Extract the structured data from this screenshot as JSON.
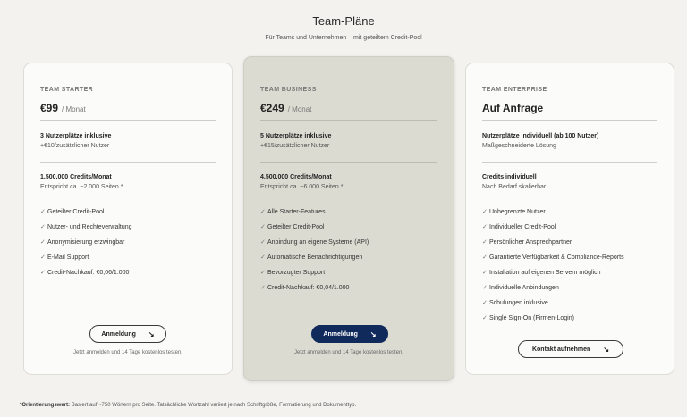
{
  "header": {
    "title": "Team-Pläne",
    "subtitle": "Für Teams und Unternehmen – mit geteiltem Credit-Pool"
  },
  "plans": [
    {
      "name": "TEAM STARTER",
      "price": "€99",
      "period": "/ Monat",
      "seats_title": "3 Nutzerplätze inklusive",
      "seats_sub": "+€10/zusätzlicher Nutzer",
      "credits_title": "1.500.000 Credits/Monat",
      "credits_sub": "Entspricht ca. ~2.000 Seiten *",
      "features": [
        "Geteilter Credit-Pool",
        "Nutzer- und Rechteverwaltung",
        "Anonymisierung erzwingbar",
        "E-Mail Support",
        "Credit-Nachkauf: €0,06/1.000"
      ],
      "button": "Anmeldung",
      "note": "Jetzt anmelden und 14 Tage kostenlos testen."
    },
    {
      "name": "TEAM BUSINESS",
      "price": "€249",
      "period": "/ Monat",
      "seats_title": "5 Nutzerplätze inklusive",
      "seats_sub": "+€15/zusätzlicher Nutzer",
      "credits_title": "4.500.000 Credits/Monat",
      "credits_sub": "Entspricht ca. ~6.000 Seiten *",
      "features": [
        "Alle Starter-Features",
        "Geteilter Credit-Pool",
        "Anbindung an eigene Systeme (API)",
        "Automatische Benachrichtigungen",
        "Bevorzugter Support",
        "Credit-Nachkauf: €0,04/1.000"
      ],
      "button": "Anmeldung",
      "note": "Jetzt anmelden und 14 Tage kostenlos testen."
    },
    {
      "name": "TEAM ENTERPRISE",
      "price": "Auf Anfrage",
      "period": "",
      "seats_title": "Nutzerplätze individuell (ab 100 Nutzer)",
      "seats_sub": "Maßgeschneiderte Lösung",
      "credits_title": "Credits individuell",
      "credits_sub": "Nach Bedarf skalierbar",
      "features": [
        "Unbegrenzte Nutzer",
        "Individueller Credit-Pool",
        "Persönlicher Ansprechpartner",
        "Garantierte Verfügbarkeit & Compliance-Reports",
        "Installation auf eigenen Servern möglich",
        "Individuelle Anbindungen",
        "Schulungen inklusive",
        "Single Sign-On (Firmen-Login)"
      ],
      "button": "Kontakt aufnehmen",
      "note": ""
    }
  ],
  "icons": {
    "check": "✓",
    "arrow": "↘"
  },
  "footnote": {
    "label": "*Orientierungswert:",
    "text": "Basiert auf ~750 Wörtern pro Seite. Tatsächliche Wortzahl variiert je nach Schriftgröße, Formatierung und Dokumenttyp."
  }
}
